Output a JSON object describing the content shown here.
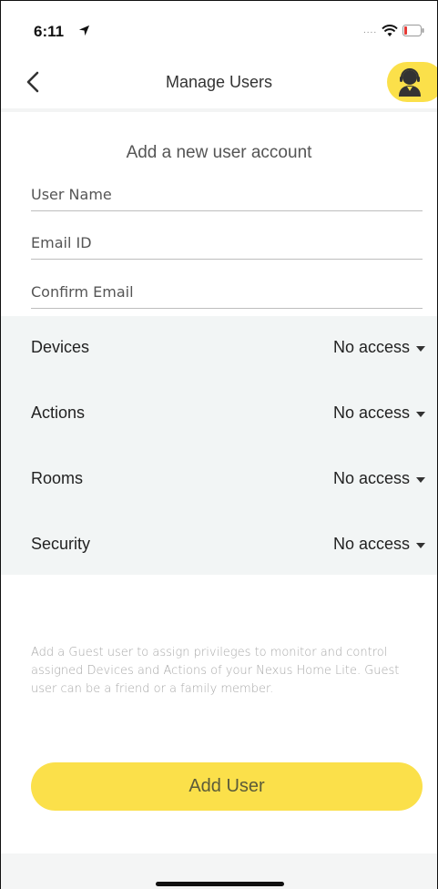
{
  "status": {
    "time": "6:11",
    "signal_dots": "....",
    "icons": [
      "location-arrow-icon",
      "wifi-icon",
      "battery-low-icon"
    ],
    "battery_color": "#e53935"
  },
  "nav": {
    "title": "Manage Users",
    "back_icon": "chevron-left-icon",
    "support_icon": "support-agent-icon"
  },
  "form": {
    "heading": "Add a new user account",
    "user_name_placeholder": "User Name",
    "email_placeholder": "Email ID",
    "confirm_email_placeholder": "Confirm Email"
  },
  "access": [
    {
      "label": "Devices",
      "value": "No access"
    },
    {
      "label": "Actions",
      "value": "No access"
    },
    {
      "label": "Rooms",
      "value": "No access"
    },
    {
      "label": "Security",
      "value": "No access"
    }
  ],
  "info_text": "Add a Guest user to assign privileges to monitor and control assigned Devices and Actions of your Nexus Home Lite. Guest user can be a friend or a family member.",
  "add_button_label": "Add User",
  "colors": {
    "accent_yellow": "#fbe04a",
    "section_background": "#f2f5f5"
  }
}
